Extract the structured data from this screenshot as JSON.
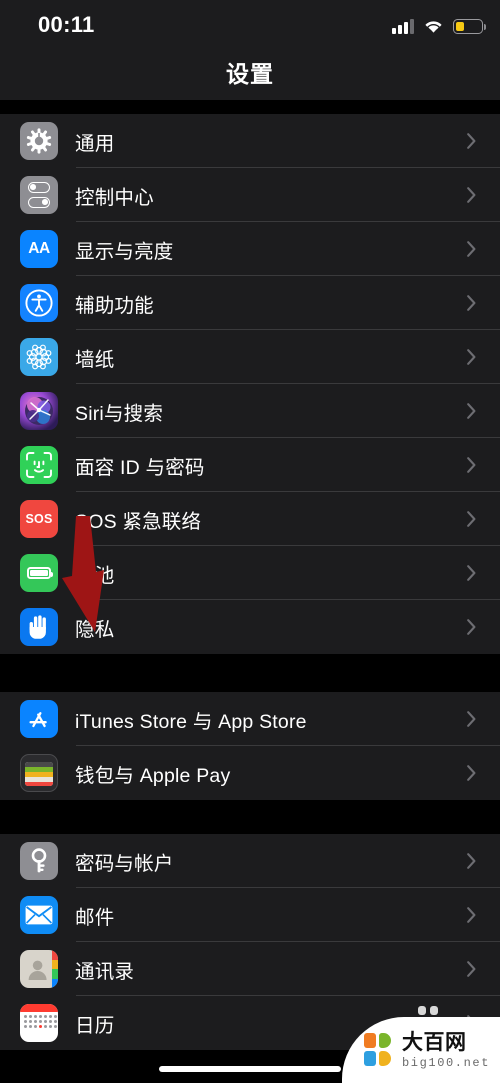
{
  "status_bar": {
    "time": "00:11",
    "signal_icon": "cellular-bars-icon",
    "wifi_icon": "wifi-icon",
    "battery_icon": "battery-low-power-icon",
    "battery_fill_percent": 35,
    "battery_color": "#f6c914"
  },
  "nav": {
    "title": "设置"
  },
  "sections": [
    {
      "rows": [
        {
          "label": "通用",
          "icon": "gear-icon",
          "icon_class": "ic-gear"
        },
        {
          "label": "控制中心",
          "icon": "control-center-icon",
          "icon_class": "ic-control"
        },
        {
          "label": "显示与亮度",
          "icon": "display-brightness-icon",
          "icon_class": "ic-display"
        },
        {
          "label": "辅助功能",
          "icon": "accessibility-icon",
          "icon_class": "ic-access"
        },
        {
          "label": "墙纸",
          "icon": "wallpaper-icon",
          "icon_class": "ic-wall"
        },
        {
          "label": "Siri与搜索",
          "icon": "siri-icon",
          "icon_class": "ic-siri"
        },
        {
          "label": "面容 ID 与密码",
          "icon": "face-id-icon",
          "icon_class": "ic-face"
        },
        {
          "label": "SOS 紧急联络",
          "icon": "sos-icon",
          "icon_class": "ic-sos"
        },
        {
          "label": "电池",
          "icon": "battery-icon",
          "icon_class": "ic-battery"
        },
        {
          "label": "隐私",
          "icon": "privacy-hand-icon",
          "icon_class": "ic-privacy"
        }
      ]
    },
    {
      "rows": [
        {
          "label": "iTunes Store 与 App Store",
          "icon": "app-store-icon",
          "icon_class": "ic-appstore"
        },
        {
          "label": "钱包与 Apple Pay",
          "icon": "wallet-icon",
          "icon_class": "ic-wallet"
        }
      ]
    },
    {
      "rows": [
        {
          "label": "密码与帐户",
          "icon": "key-icon",
          "icon_class": "ic-passwd"
        },
        {
          "label": "邮件",
          "icon": "mail-icon",
          "icon_class": "ic-mail"
        },
        {
          "label": "通讯录",
          "icon": "contacts-icon",
          "icon_class": "ic-contacts"
        },
        {
          "label": "日历",
          "icon": "calendar-icon",
          "icon_class": "ic-calendar"
        }
      ]
    }
  ],
  "annotation": {
    "arrow_icon": "red-down-arrow-annotation",
    "arrow_color": "#9e1515",
    "points_to": "隐私"
  },
  "watermark": {
    "logo_icon": "big100-logo-icon",
    "name_cn": "大百网",
    "name_en": "big100.net",
    "logo_colors": [
      "#f07c22",
      "#7ab52b",
      "#2e9fe0",
      "#f0b21e"
    ]
  },
  "home_indicator": {
    "icon": "home-indicator"
  }
}
